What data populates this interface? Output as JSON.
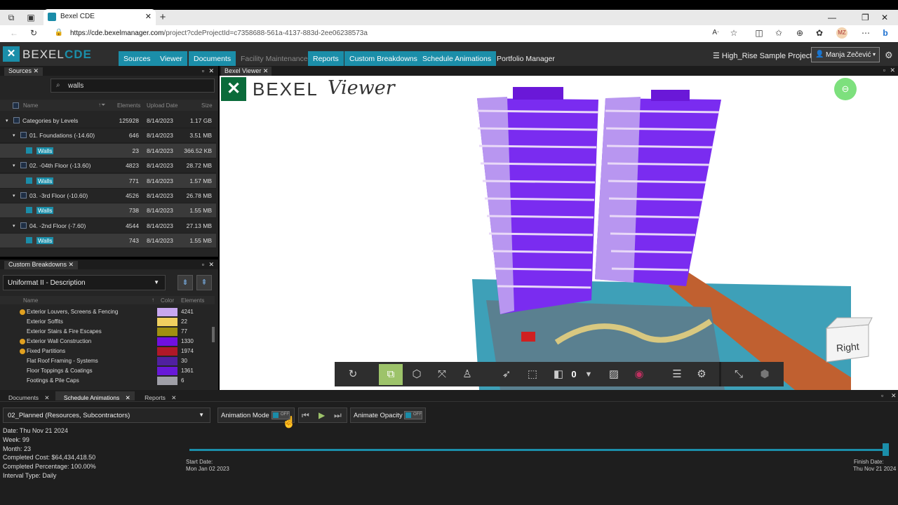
{
  "browser": {
    "tab_title": "Bexel CDE",
    "url_host": "https://cde.bexelmanager.com",
    "url_path": "/project?cdeProjectId=c7358688-561a-4137-883d-2ee06238573a",
    "profile_initials": "MZ"
  },
  "app": {
    "logo_text_left": "BEXEL",
    "logo_text_right": "CDE",
    "nav": [
      "Sources",
      "Viewer",
      "Documents",
      "Facility Maintenance",
      "Reports",
      "Custom Breakdowns",
      "Schedule Animations",
      "Portfolio Manager"
    ],
    "project_name": "High_Rise Sample Project",
    "user_name": "Manja Zečević",
    "accent_color": "#1b8ea9"
  },
  "sources": {
    "tab_label": "Sources",
    "search_value": "walls",
    "columns": [
      "Name",
      "Elements",
      "Upload Date",
      "Size"
    ],
    "rows": [
      {
        "name": "Categories by Levels",
        "elements": "125928",
        "date": "8/14/2023",
        "size": "1.17 GB"
      },
      {
        "name": "01. Foundations (-14.60)",
        "elements": "646",
        "date": "8/14/2023",
        "size": "3.51 MB"
      },
      {
        "name": "Walls",
        "elements": "23",
        "date": "8/14/2023",
        "size": "366.52 KB"
      },
      {
        "name": "02. -04th Floor (-13.60)",
        "elements": "4823",
        "date": "8/14/2023",
        "size": "28.72 MB"
      },
      {
        "name": "Walls",
        "elements": "771",
        "date": "8/14/2023",
        "size": "1.57 MB"
      },
      {
        "name": "03. -3rd Floor (-10.60)",
        "elements": "4526",
        "date": "8/14/2023",
        "size": "26.78 MB"
      },
      {
        "name": "Walls",
        "elements": "738",
        "date": "8/14/2023",
        "size": "1.55 MB"
      },
      {
        "name": "04. -2nd Floor (-7.60)",
        "elements": "4544",
        "date": "8/14/2023",
        "size": "27.13 MB"
      },
      {
        "name": "Walls",
        "elements": "743",
        "date": "8/14/2023",
        "size": "1.55 MB"
      }
    ]
  },
  "custom_breakdowns": {
    "tab_label": "Custom Breakdowns",
    "selected": "Uniformat II - Description",
    "columns": [
      "Name",
      "Color",
      "Elements"
    ],
    "rows": [
      {
        "name": "Exterior Louvers, Screens & Fencing",
        "color": "#c8a8f0",
        "elements": "4241",
        "dot": true
      },
      {
        "name": "Exterior Soffits",
        "color": "#f0d060",
        "elements": "22",
        "dot": false
      },
      {
        "name": "Exterior Stairs & Fire Escapes",
        "color": "#a09010",
        "elements": "77",
        "dot": false
      },
      {
        "name": "Exterior Wall Construction",
        "color": "#7010e0",
        "elements": "1330",
        "dot": true
      },
      {
        "name": "Fixed Partitions",
        "color": "#b01828",
        "elements": "1974",
        "dot": true
      },
      {
        "name": "Flat Roof Framing - Systems",
        "color": "#5020a0",
        "elements": "30",
        "dot": false
      },
      {
        "name": "Floor Toppings & Coatings",
        "color": "#6818d8",
        "elements": "1361",
        "dot": false
      },
      {
        "name": "Footings & Pile Caps",
        "color": "#a0a0a8",
        "elements": "6",
        "dot": false
      }
    ]
  },
  "viewer": {
    "tab_label": "Bexel Viewer",
    "brand_left": "BEXEL",
    "brand_right": "Viewer",
    "cube_label": "Right",
    "counter": "0"
  },
  "bottom": {
    "tabs": [
      "Documents",
      "Schedule Animations",
      "Reports"
    ],
    "schedule_select": "02_Planned (Resources, Subcontractors)",
    "animation_mode_label": "Animation Mode",
    "animation_mode_state": "OFF",
    "animate_opacity_label": "Animate Opacity",
    "animate_opacity_state": "OFF",
    "info": [
      "Date: Thu Nov 21 2024",
      "Week: 99",
      "Month: 23",
      "Completed Cost: $64,434,418.50",
      "Completed Percentage: 100.00%",
      "Interval Type: Daily"
    ],
    "progress": 1.0,
    "start_label": "Start Date:",
    "start_date": "Mon Jan 02 2023",
    "finish_label": "Finish Date:",
    "finish_date": "Thu Nov 21 2024"
  }
}
